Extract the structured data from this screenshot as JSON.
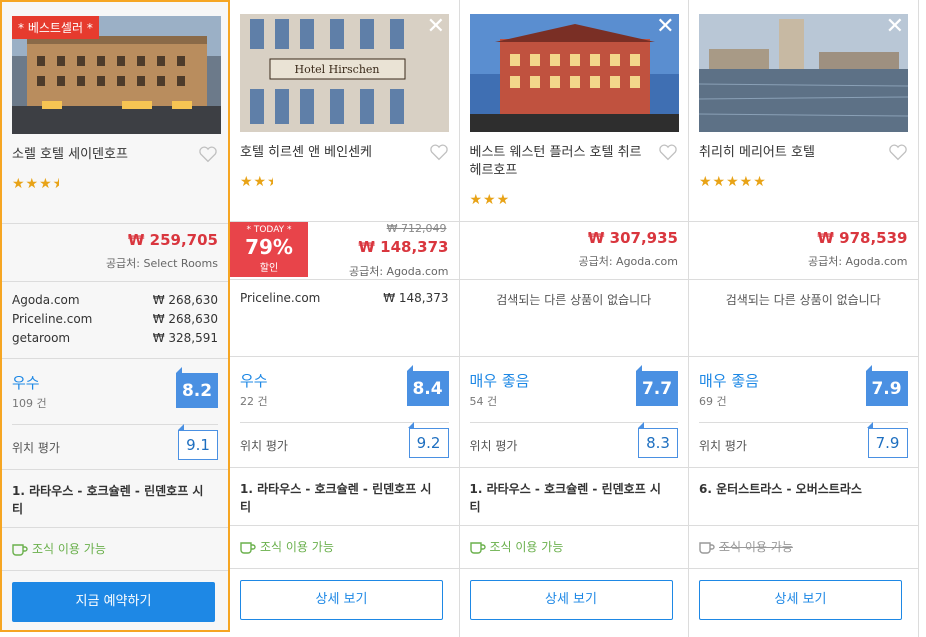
{
  "colors": {
    "accent": "#1e88e5",
    "price_red": "#d9363e",
    "star": "#e8a317",
    "featured_border": "#f6a623",
    "breakfast_green": "#6ab04c"
  },
  "hotels": [
    {
      "name": "소렐 호텔 세이덴호프",
      "badge": "* 베스트셀러 *",
      "stars": "★★★",
      "star_half": true,
      "price": "₩ 259,705",
      "supplier": "공급처: Select Rooms",
      "other_offers": [
        {
          "site": "Agoda.com",
          "price": "₩ 268,630"
        },
        {
          "site": "Priceline.com",
          "price": "₩ 268,630"
        },
        {
          "site": "getaroom",
          "price": "₩ 328,591"
        }
      ],
      "rating_word": "우수",
      "rating_count": "109 건",
      "score": "8.2",
      "location_label": "위치 평가",
      "location_score": "9.1",
      "area": "1. 라타우스 - 호크슐렌 - 린덴호프 시티",
      "breakfast": "조식 이용 가능",
      "cta": "지금 예약하기"
    },
    {
      "name": "호텔 히르셴 앤 베인센케",
      "stars": "★★",
      "star_half": true,
      "today_top": "* TODAY *",
      "discount": "79%",
      "discount_label": "할인",
      "old_price": "₩ 712,049",
      "price": "₩ 148,373",
      "supplier": "공급처: Agoda.com",
      "other_offers": [
        {
          "site": "Priceline.com",
          "price": "₩ 148,373"
        }
      ],
      "rating_word": "우수",
      "rating_count": "22 건",
      "score": "8.4",
      "location_label": "위치 평가",
      "location_score": "9.2",
      "area": "1. 라타우스 - 호크슐렌 - 린덴호프 시티",
      "breakfast": "조식 이용 가능",
      "cta": "상세 보기"
    },
    {
      "name": "베스트 웨스턴 플러스 호텔 취르헤르호프",
      "stars": "★★★",
      "price": "₩ 307,935",
      "supplier": "공급처: Agoda.com",
      "no_other": "검색되는 다른 상품이 없습니다",
      "rating_word": "매우 좋음",
      "rating_count": "54 건",
      "score": "7.7",
      "location_label": "위치 평가",
      "location_score": "8.3",
      "area": "1. 라타우스 - 호크슐렌 - 린덴호프 시티",
      "breakfast": "조식 이용 가능",
      "cta": "상세 보기"
    },
    {
      "name": "취리히 메리어트 호텔",
      "stars": "★★★★★",
      "price": "₩ 978,539",
      "supplier": "공급처: Agoda.com",
      "no_other": "검색되는 다른 상품이 없습니다",
      "rating_word": "매우 좋음",
      "rating_count": "69 건",
      "score": "7.9",
      "location_label": "위치 평가",
      "location_score": "7.9",
      "area": "6. 운터스트라스 - 오버스트라스",
      "breakfast": "조식 이용 가능",
      "cta": "상세 보기"
    }
  ]
}
